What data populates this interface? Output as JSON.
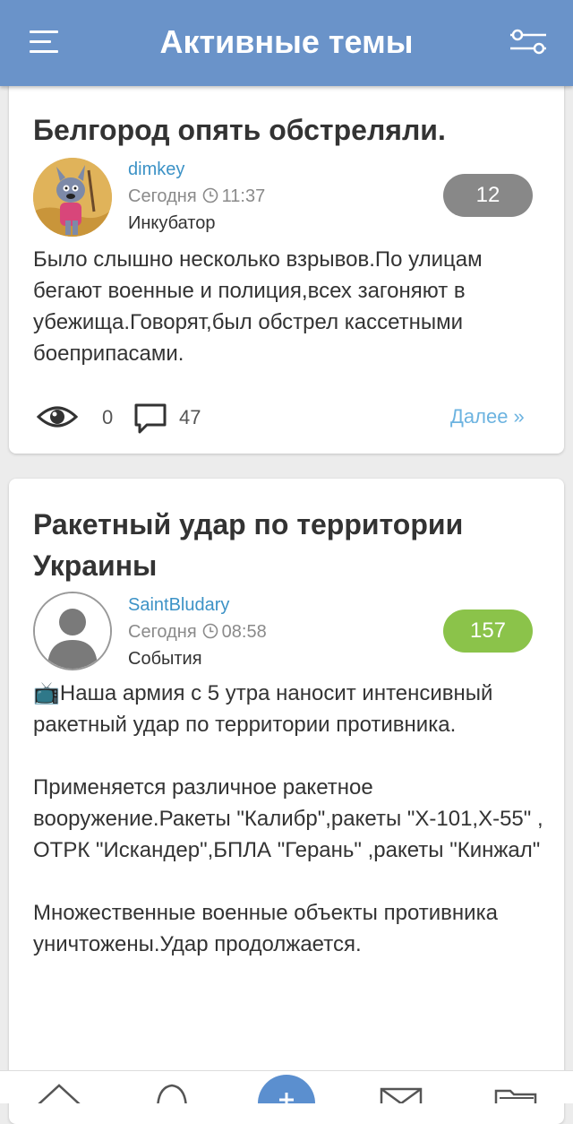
{
  "header": {
    "title": "Активные темы",
    "menu_icon": "menu-icon",
    "filter_icon": "sliders-icon",
    "background_color": "#6a93c9"
  },
  "topics": [
    {
      "title": "Белгород опять обстреляли.",
      "author": "dimkey",
      "date": "Сегодня",
      "time": "11:37",
      "forum": "Инкубатор",
      "replies": "12",
      "badge_color": "#888888",
      "body": "Было слышно несколько взрывов.По улицам бегают военные и полиция,всех загоняют в убежища.Говорят,был обстрел кассетными боеприпасами.",
      "views": "0",
      "comments": "47",
      "more": "Далее »"
    },
    {
      "title": "Ракетный удар по территории Украины",
      "author": "SaintBludary",
      "date": "Сегодня",
      "time": "08:58",
      "forum": "События",
      "replies": "157",
      "badge_color": "#8bc34a",
      "body_emoji": "📺",
      "body": "Наша армия с 5 утра наносит интенсивный ракетный удар по территории противника.\n\nПрименяется различное ракетное вооружение.Ракеты \"Калибр\",ракеты \"X-101,X-55\" , ОТРК \"Искандер\",БПЛА \"Герань\" ,ракеты \"Кинжал\"\n\nМножественные военные объекты противника уничтожены.Удар продолжается."
    }
  ],
  "bottom_nav": {
    "items": [
      "home-icon",
      "bell-icon",
      "add-icon",
      "mail-icon",
      "folder-icon"
    ],
    "accent_color": "#5b8fcf"
  }
}
